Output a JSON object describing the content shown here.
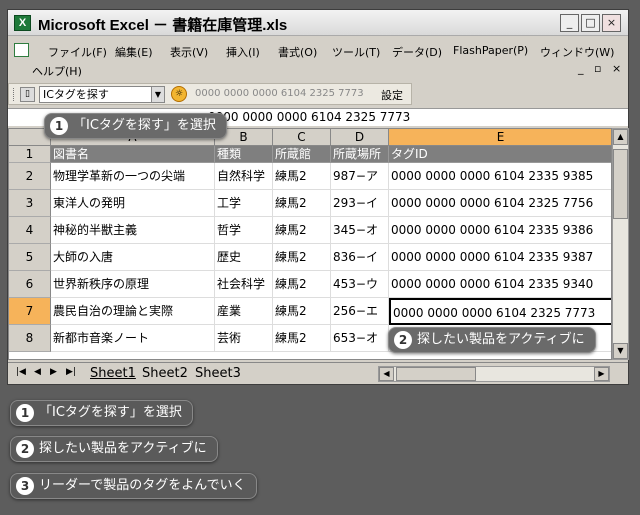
{
  "window": {
    "title": "Microsoft Excel － 書籍在庫管理.xls",
    "app_icon": "excel-icon",
    "minimize": "_",
    "maximize": "□",
    "close": "×"
  },
  "menu": {
    "items": [
      "ファイル(F)",
      "編集(E)",
      "表示(V)",
      "挿入(I)",
      "書式(O)",
      "ツール(T)",
      "データ(D)",
      "FlashPaper(P)",
      "ウィンドウ(W)"
    ],
    "help": "ヘルプ(H)",
    "mdi_min": "_",
    "mdi_restore": "▫",
    "mdi_close": "×"
  },
  "toolbar": {
    "dropdown_value": "ICタグを探す",
    "tag_field": "0000 0000 0000 6104 2325 7773",
    "settings_label": "設定"
  },
  "formula": {
    "value": "0000 0000 0000 6104 2325 7773"
  },
  "columns": [
    "A",
    "B",
    "C",
    "D",
    "E"
  ],
  "header_row": {
    "num": "1",
    "cells": [
      "図書名",
      "種類",
      "所蔵館",
      "所蔵場所",
      "タグID"
    ]
  },
  "rows": [
    {
      "num": "2",
      "cells": [
        "物理学革新の一つの尖端",
        "自然科学",
        "練馬2",
        "987−ア",
        "0000 0000 0000 6104 2335 9385"
      ]
    },
    {
      "num": "3",
      "cells": [
        "東洋人の発明",
        "工学",
        "練馬2",
        "293−イ",
        "0000 0000 0000 6104 2325 7756"
      ]
    },
    {
      "num": "4",
      "cells": [
        "神秘的半獣主義",
        "哲学",
        "練馬2",
        "345−オ",
        "0000 0000 0000 6104 2335 9386"
      ]
    },
    {
      "num": "5",
      "cells": [
        "大師の入唐",
        "歴史",
        "練馬2",
        "836−イ",
        "0000 0000 0000 6104 2335 9387"
      ]
    },
    {
      "num": "6",
      "cells": [
        "世界新秩序の原理",
        "社会科学",
        "練馬2",
        "453−ウ",
        "0000 0000 0000 6104 2335 9340"
      ]
    },
    {
      "num": "7",
      "cells": [
        "農民自治の理論と実際",
        "産業",
        "練馬2",
        "256−エ",
        "0000 0000 0000 6104 2325 7773"
      ]
    },
    {
      "num": "8",
      "cells": [
        "新都市音楽ノート",
        "芸術",
        "練馬2",
        "653−オ",
        ""
      ]
    }
  ],
  "sheets": [
    "Sheet1",
    "Sheet2",
    "Sheet3"
  ],
  "callouts": {
    "c1": {
      "num": "1",
      "text": "「ICタグを探す」を選択"
    },
    "c2": {
      "num": "2",
      "text": "探したい製品をアクティブに"
    },
    "c3": {
      "num": "3",
      "text": "リーダーで製品のタグをよんでいく"
    }
  }
}
